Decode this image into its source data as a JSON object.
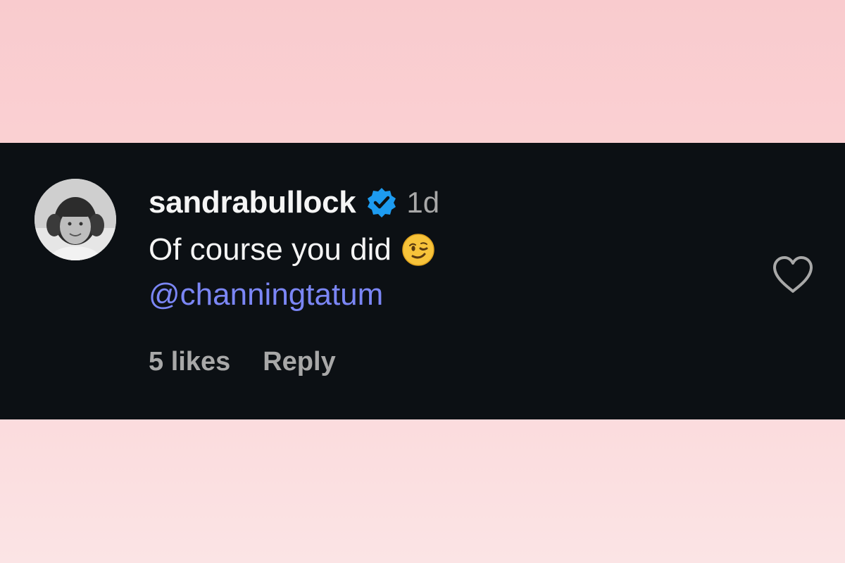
{
  "comment": {
    "username": "sandrabullock",
    "verified": true,
    "timestamp": "1d",
    "text": "Of course you did",
    "emoji_icon": "winking-face-emoji",
    "mention": "@channingtatum",
    "likes_label": "5 likes",
    "reply_label": "Reply",
    "like_icon": "heart-outline-icon"
  },
  "colors": {
    "background_top": "#f9cbce",
    "background_bottom": "#fbe4e5",
    "card": "#0c1014",
    "username": "#f5f5f5",
    "muted": "#a8a8a8",
    "mention": "#7b86f5",
    "verified_badge": "#1d9bf0"
  }
}
